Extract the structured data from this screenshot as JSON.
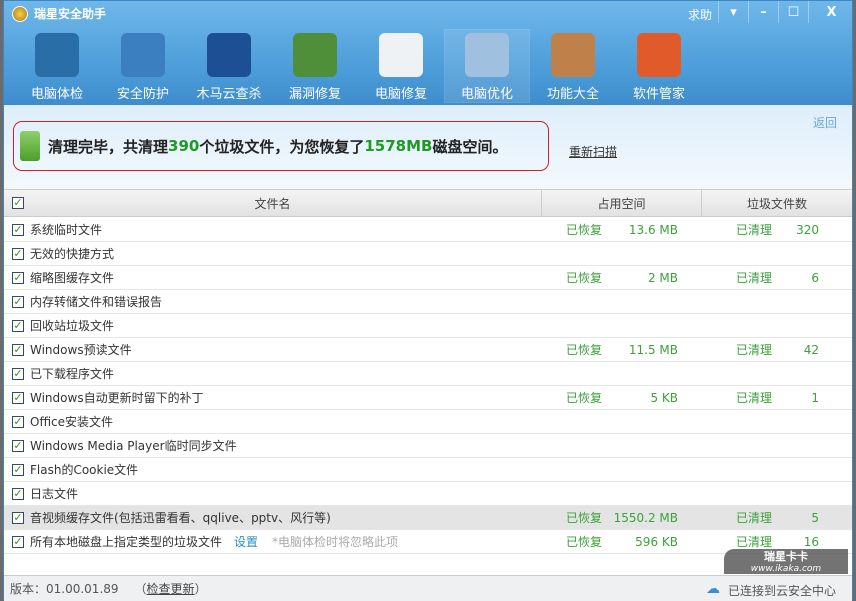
{
  "app": {
    "title": "瑞星安全助手",
    "help": "求助",
    "buttons": {
      "menu": "▾",
      "min": "–",
      "max": "☐",
      "close": "X"
    }
  },
  "toolbar": [
    {
      "label": "电脑体检",
      "icon": "monitor-pulse-icon",
      "color": "#2a6ea8"
    },
    {
      "label": "安全防护",
      "icon": "firewall-icon",
      "color": "#3b7fc0"
    },
    {
      "label": "木马云查杀",
      "icon": "shield-icon",
      "color": "#1c4f94"
    },
    {
      "label": "漏洞修复",
      "icon": "windows-update-icon",
      "color": "#4f8f3a"
    },
    {
      "label": "电脑修复",
      "icon": "checklist-icon",
      "color": "#eef2f5"
    },
    {
      "label": "电脑优化",
      "icon": "monitor-wand-icon",
      "color": "#9fc0de",
      "active": true
    },
    {
      "label": "功能大全",
      "icon": "disc-icon",
      "color": "#c0804a"
    },
    {
      "label": "软件管家",
      "icon": "software-box-icon",
      "color": "#e05a2a"
    }
  ],
  "summary": {
    "t1": "清理完毕，共清理 ",
    "count": "390",
    "t2": " 个垃圾文件，为您恢复了 ",
    "size": "1578MB",
    "t3": " 磁盘空间。",
    "rescan": "重新扫描",
    "back": "返回"
  },
  "table": {
    "headers": [
      "文件名",
      "占用空间",
      "垃圾文件数"
    ],
    "rows": [
      {
        "name": "系统临时文件",
        "recovered": "已恢复",
        "size": "13.6 MB",
        "cleaned": "已清理",
        "count": "320"
      },
      {
        "name": "无效的快捷方式"
      },
      {
        "name": "缩略图缓存文件",
        "recovered": "已恢复",
        "size": "2 MB",
        "cleaned": "已清理",
        "count": "6"
      },
      {
        "name": "内存转储文件和错误报告"
      },
      {
        "name": "回收站垃圾文件"
      },
      {
        "name": "Windows预读文件",
        "recovered": "已恢复",
        "size": "11.5 MB",
        "cleaned": "已清理",
        "count": "42"
      },
      {
        "name": "已下载程序文件"
      },
      {
        "name": "Windows自动更新时留下的补丁",
        "recovered": "已恢复",
        "size": "5 KB",
        "cleaned": "已清理",
        "count": "1"
      },
      {
        "name": "Office安装文件"
      },
      {
        "name": "Windows Media Player临时同步文件"
      },
      {
        "name": "Flash的Cookie文件"
      },
      {
        "name": "日志文件"
      },
      {
        "name": "音视频缓存文件(包括迅雷看看、qqlive、pptv、风行等)",
        "recovered": "已恢复",
        "size": "1550.2 MB",
        "cleaned": "已清理",
        "count": "5",
        "highlight": true
      },
      {
        "name": "所有本地磁盘上指定类型的垃圾文件",
        "link": "设置",
        "note": "*电脑体检时将忽略此项",
        "recovered": "已恢复",
        "size": "596 KB",
        "cleaned": "已清理",
        "count": "16"
      }
    ]
  },
  "footer": {
    "version": "版本：01.00.01.89",
    "check_pre": "（",
    "check": "检查更新",
    "check_post": "）",
    "status": "已连接到云安全中心"
  },
  "watermark": {
    "brand": "瑞星卡卡",
    "url": "www.ikaka.com"
  }
}
